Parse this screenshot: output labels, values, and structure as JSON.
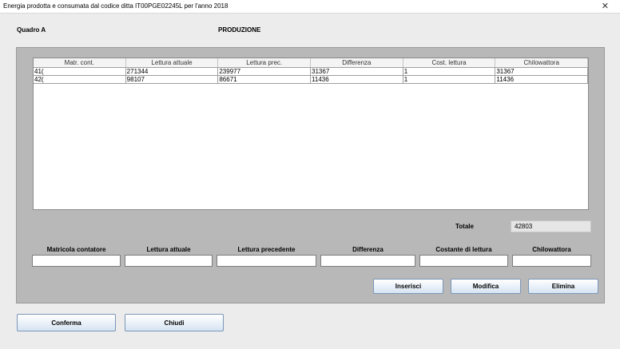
{
  "window": {
    "title": "Energia prodotta e consumata dal codice ditta IT00PGE02245L per l'anno 2018",
    "close_glyph": "✕"
  },
  "header": {
    "quadro": "Quadro A",
    "section": "PRODUZIONE"
  },
  "table": {
    "columns": [
      "Matr. cont.",
      "Lettura attuale",
      "Lettura prec.",
      "Differenza",
      "Cost. lettura",
      "Chilowattora"
    ],
    "rows": [
      [
        "41(",
        "271344",
        "239977",
        "31367",
        "1",
        "31367"
      ],
      [
        "42(",
        "98107",
        "86671",
        "11436",
        "1",
        "11436"
      ]
    ]
  },
  "totale": {
    "label": "Totale",
    "value": "42803"
  },
  "form": {
    "labels": [
      "Matricola contatore",
      "Lettura attuale",
      "Lettura precedente",
      "Differenza",
      "Costante di lettura",
      "Chilowattora"
    ]
  },
  "actions": {
    "inserisci": "Inserisci",
    "modifica": "Modifica",
    "elimina": "Elimina"
  },
  "footer": {
    "conferma": "Conferma",
    "chiudi": "Chiudi"
  }
}
